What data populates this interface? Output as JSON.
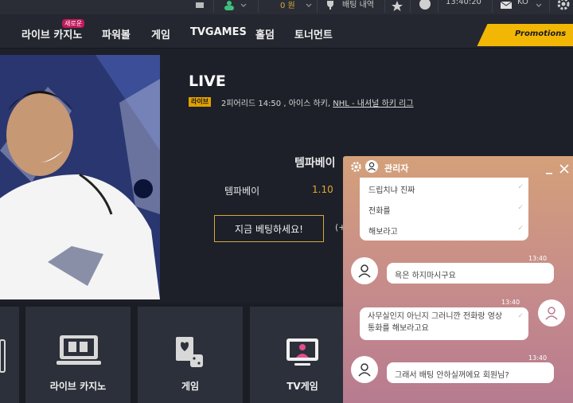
{
  "topbar": {
    "balance": "0 원",
    "bet_history": "배팅 내역",
    "clock": "13:40:20",
    "language": "KO"
  },
  "nav": {
    "items": [
      "라이브 카지노",
      "파워볼",
      "게임",
      "TVGAMES",
      "홀덤",
      "토너먼트"
    ],
    "new_badge": "새로운",
    "promotions": "Promotions"
  },
  "hero": {
    "title": "LIVE",
    "live_tag": "라이브",
    "match_info": "2피어리드 14:50 , 아이스 하키,",
    "league": "NHL - 내셔널 하키 리그",
    "market_title": "템파베이",
    "selection_name": "템파베이",
    "selection_odds": "1.10",
    "bet_button": "지금 베팅하세요!",
    "more_bets": "(+"
  },
  "categories": [
    {
      "label": ""
    },
    {
      "label": "라이브 카지노"
    },
    {
      "label": "게임"
    },
    {
      "label": "TV게임"
    }
  ],
  "chat": {
    "title": "관리자",
    "messages": [
      {
        "side": "right",
        "lines": [
          "드립치냐 진짜",
          "전화를",
          "해보라고"
        ],
        "time": ""
      },
      {
        "side": "left",
        "text": "욕은 하지마시구요",
        "time": "13:40"
      },
      {
        "side": "right",
        "text": "사무실인지 아닌지 그러니깐 전화랑 영상통화를 해보라고요",
        "time": "13:40"
      },
      {
        "side": "left",
        "text": "그래서 배팅 안하실꺼에요 회원님?",
        "time": "13:40"
      }
    ]
  }
}
